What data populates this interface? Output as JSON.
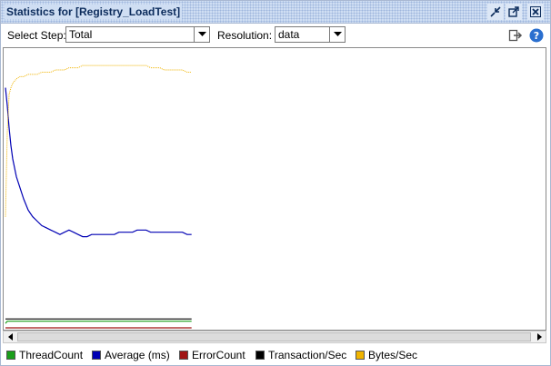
{
  "window": {
    "title": "Statistics for [Registry_LoadTest]"
  },
  "toolbar": {
    "step_label": "Select Step:",
    "step_value": "Total",
    "resolution_label": "Resolution:",
    "resolution_value": "data"
  },
  "legend": {
    "items": [
      {
        "label": "ThreadCount",
        "color": "#1a9e1a"
      },
      {
        "label": "Average (ms)",
        "color": "#0000b4"
      },
      {
        "label": "ErrorCount",
        "color": "#a01414"
      },
      {
        "label": "Transaction/Sec",
        "color": "#000000"
      },
      {
        "label": "Bytes/Sec",
        "color": "#f0b400"
      }
    ]
  },
  "chart_data": {
    "type": "line",
    "x": [
      0,
      2,
      4,
      6,
      8,
      10,
      12,
      16,
      20,
      25,
      30,
      35,
      40,
      45,
      50,
      55,
      60,
      65,
      70,
      75,
      80,
      85,
      90,
      95,
      100,
      105,
      110,
      115,
      120,
      125,
      130,
      135,
      140,
      145,
      150,
      155,
      160,
      165,
      170,
      175,
      180,
      185,
      190,
      195,
      200,
      205
    ],
    "series": [
      {
        "name": "Bytes/Sec",
        "color": "#f0b400",
        "values": [
          50,
          88,
          105,
          108,
          110,
          111,
          112,
          113,
          113,
          114,
          114,
          114,
          115,
          115,
          115,
          116,
          116,
          116,
          117,
          117,
          117,
          118,
          118,
          118,
          118,
          118,
          118,
          118,
          118,
          118,
          118,
          118,
          118,
          118,
          118,
          118,
          117,
          117,
          117,
          116,
          116,
          116,
          116,
          116,
          115,
          115
        ]
      },
      {
        "name": "Average (ms)",
        "color": "#0000b4",
        "values": [
          108,
          100,
          90,
          82,
          76,
          72,
          68,
          63,
          58,
          53,
          50,
          48,
          46,
          45,
          44,
          43,
          42,
          43,
          44,
          43,
          42,
          41,
          41,
          42,
          42,
          42,
          42,
          42,
          42,
          43,
          43,
          43,
          43,
          44,
          44,
          44,
          43,
          43,
          43,
          43,
          43,
          43,
          43,
          43,
          42,
          42
        ]
      },
      {
        "name": "ThreadCount",
        "color": "#1a9e1a",
        "values": [
          2,
          3,
          3,
          3,
          3,
          3,
          3,
          3,
          3,
          3,
          3,
          3,
          3,
          3,
          3,
          3,
          3,
          3,
          3,
          3,
          3,
          3,
          3,
          3,
          3,
          3,
          3,
          3,
          3,
          3,
          3,
          3,
          3,
          3,
          3,
          3,
          3,
          3,
          3,
          3,
          3,
          3,
          3,
          3,
          3,
          3
        ]
      },
      {
        "name": "Transaction/Sec",
        "color": "#000000",
        "values": [
          4,
          4,
          4,
          4,
          4,
          4,
          4,
          4,
          4,
          4,
          4,
          4,
          4,
          4,
          4,
          4,
          4,
          4,
          4,
          4,
          4,
          4,
          4,
          4,
          4,
          4,
          4,
          4,
          4,
          4,
          4,
          4,
          4,
          4,
          4,
          4,
          4,
          4,
          4,
          4,
          4,
          4,
          4,
          4,
          4,
          4
        ]
      },
      {
        "name": "ErrorCount",
        "color": "#a01414",
        "values": [
          0,
          0,
          0,
          0,
          0,
          0,
          0,
          0,
          0,
          0,
          0,
          0,
          0,
          0,
          0,
          0,
          0,
          0,
          0,
          0,
          0,
          0,
          0,
          0,
          0,
          0,
          0,
          0,
          0,
          0,
          0,
          0,
          0,
          0,
          0,
          0,
          0,
          0,
          0,
          0,
          0,
          0,
          0,
          0,
          0,
          0
        ]
      }
    ],
    "xlim": [
      0,
      595
    ],
    "ylim": [
      0,
      125
    ],
    "grid": false
  }
}
